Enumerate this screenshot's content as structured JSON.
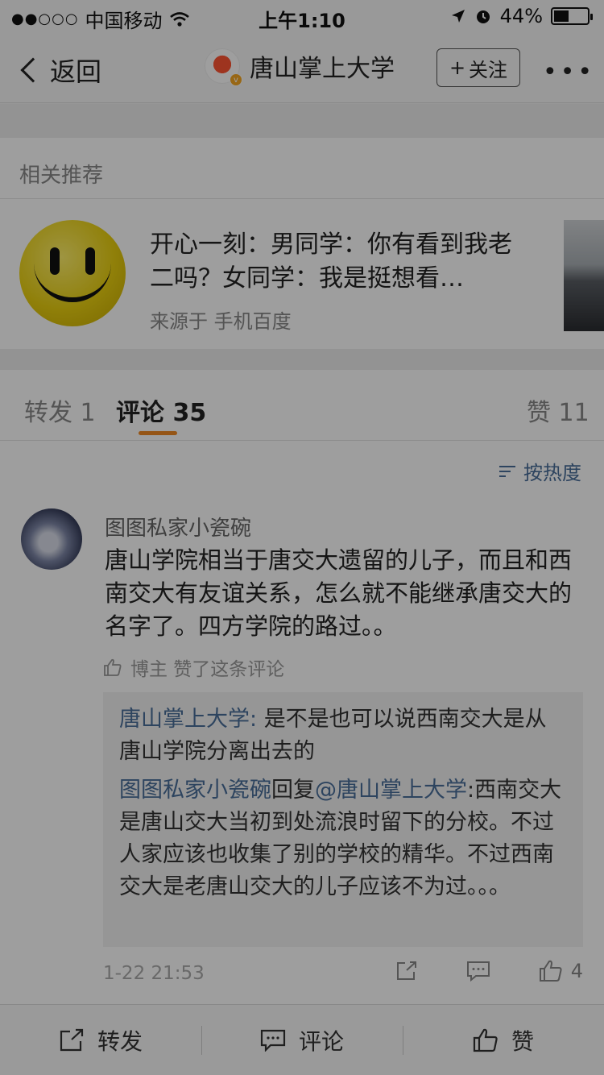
{
  "status_bar": {
    "signal_dots": "●●○○○",
    "carrier": "中国移动",
    "time": "上午1:10",
    "battery_percent": "44%",
    "battery_level": 0.44
  },
  "nav": {
    "back_label": "返回",
    "title": "唐山掌上大学",
    "follow_label": "关注",
    "follow_plus": "+",
    "more": "•••"
  },
  "recommend": {
    "header": "相关推荐",
    "title": "开心一刻：男同学：你有看到我老二吗？女同学：我是挺想看…",
    "source": "来源于 手机百度"
  },
  "tabs": {
    "repost": "转发",
    "repost_count": "1",
    "comment": "评论",
    "comment_count": "35",
    "like": "赞",
    "like_count": "11"
  },
  "sort_label": "按热度",
  "comment": {
    "user": "图图私家小瓷碗",
    "text": "唐山学院相当于唐交大遗留的儿子，而且和西南交大有友谊关系，怎么就不能继承唐交大的名字了。四方学院的路过。。",
    "liked_note": "博主 赞了这条评论",
    "replies": [
      {
        "user": "唐山掌上大学",
        "sep": ": ",
        "text": "是不是也可以说西南交大是从唐山学院分离出去的"
      },
      {
        "user": "图图私家小瓷碗",
        "mid": "回复",
        "mention": "@唐山掌上大学",
        "sep": ":",
        "text": "西南交大是唐山交大当初到处流浪时留下的分校。不过人家应该也收集了别的学校的精华。不过西南交大是老唐山交大的儿子应该不为过。。。"
      }
    ],
    "time": "1-22 21:53",
    "like_count": "4"
  },
  "bottom": {
    "repost": "转发",
    "comment": "评论",
    "like": "赞"
  },
  "colors": {
    "accent": "#f08a24",
    "link": "#4a6e9a"
  }
}
